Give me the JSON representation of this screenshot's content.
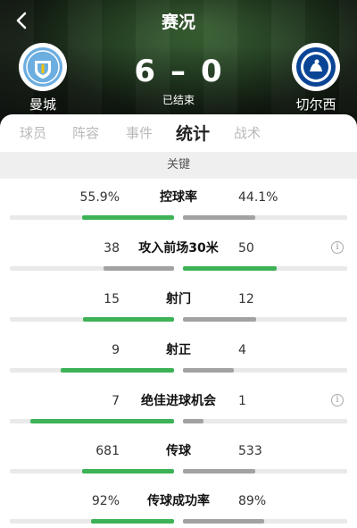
{
  "header": {
    "title": "赛况",
    "home_team": "曼城",
    "away_team": "切尔西",
    "home_score": "6",
    "separator": "–",
    "away_score": "0",
    "status": "已结束"
  },
  "tabs": [
    "球员",
    "阵容",
    "事件",
    "统计",
    "战术"
  ],
  "active_tab": "统计",
  "section": "关键",
  "stats": [
    {
      "name": "控球率",
      "home": "55.9%",
      "away": "44.1%",
      "home_share": 0.559,
      "away_share": 0.441,
      "leader": "home",
      "info": false
    },
    {
      "name": "攻入前场30米",
      "home": "38",
      "away": "50",
      "home_share": 0.43,
      "away_share": 0.57,
      "leader": "away",
      "info": true
    },
    {
      "name": "射门",
      "home": "15",
      "away": "12",
      "home_share": 0.556,
      "away_share": 0.444,
      "leader": "home",
      "info": false
    },
    {
      "name": "射正",
      "home": "9",
      "away": "4",
      "home_share": 0.692,
      "away_share": 0.308,
      "leader": "home",
      "info": false
    },
    {
      "name": "绝佳进球机会",
      "home": "7",
      "away": "1",
      "home_share": 0.875,
      "away_share": 0.125,
      "leader": "home",
      "info": true
    },
    {
      "name": "传球",
      "home": "681",
      "away": "533",
      "home_share": 0.561,
      "away_share": 0.439,
      "leader": "home",
      "info": false
    },
    {
      "name": "传球成功率",
      "home": "92%",
      "away": "89%",
      "home_share": 0.508,
      "away_share": 0.492,
      "leader": "home",
      "info": false
    }
  ],
  "colors": {
    "leader_bar": "#3db256",
    "trailer_bar": "#a2a2a2",
    "track": "#e9e9e9"
  }
}
